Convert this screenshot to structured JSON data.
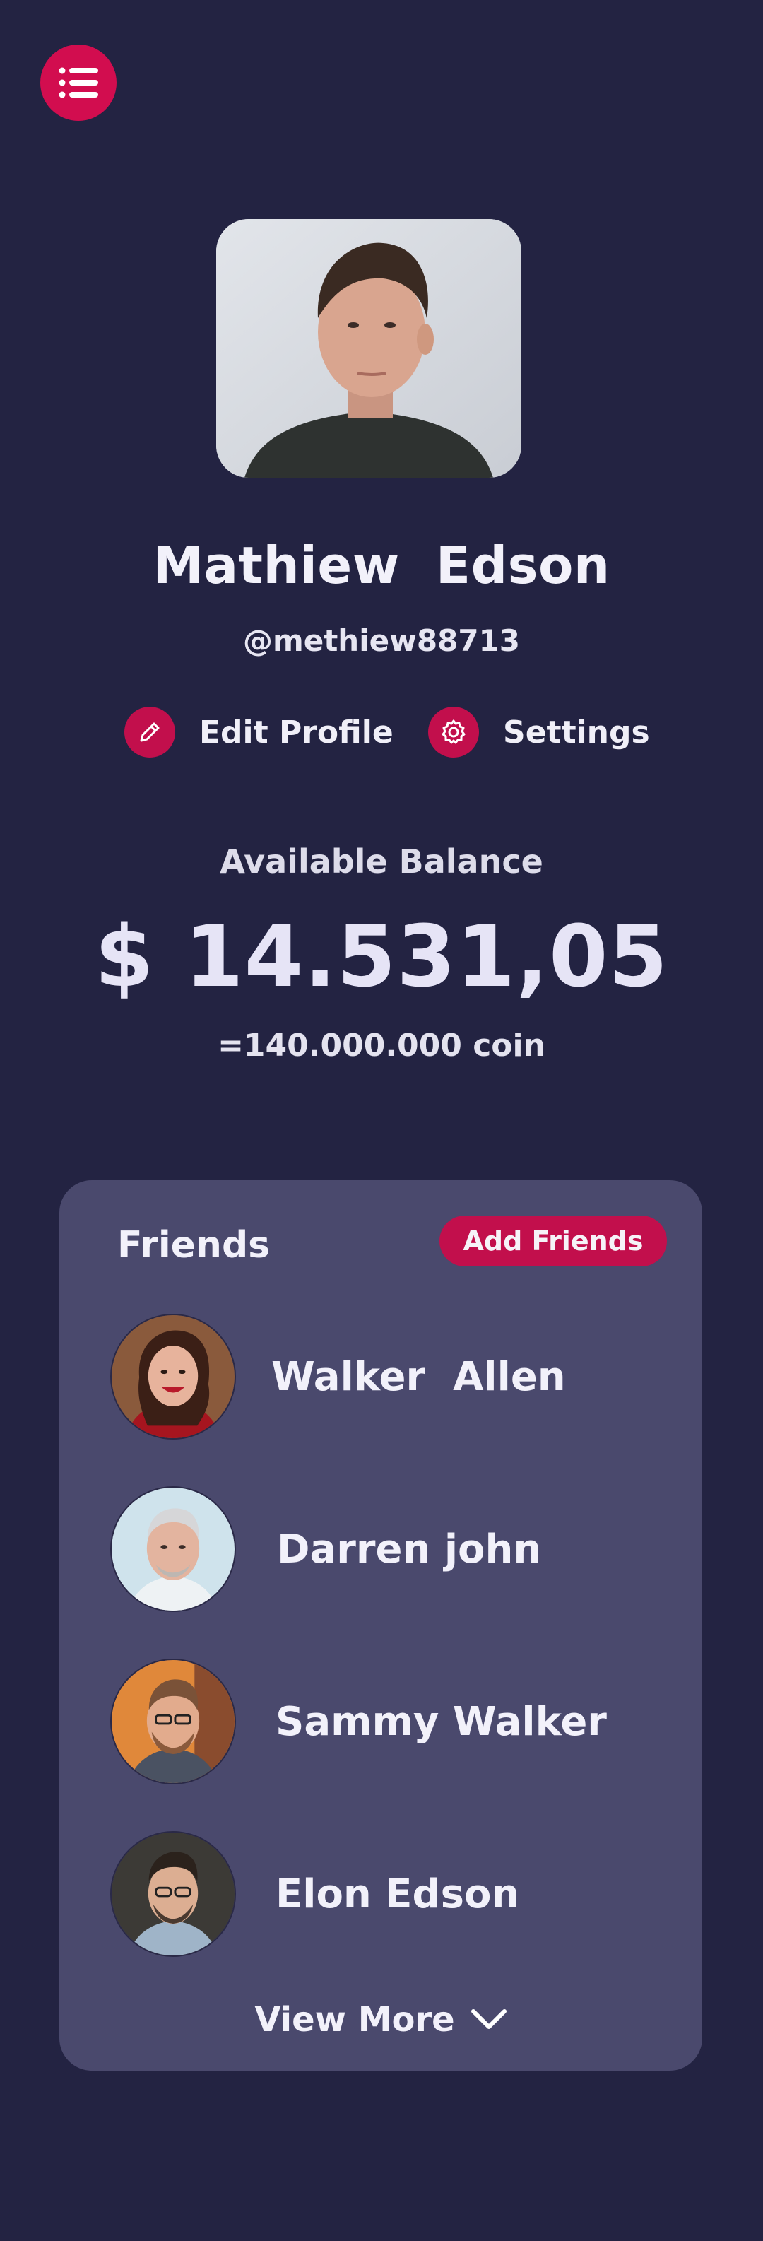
{
  "colors": {
    "background": "#232342",
    "card": "#4a496d",
    "accent": "#c20f4c",
    "text": "#f2f1fa"
  },
  "menu": {
    "icon": "list-menu-icon"
  },
  "profile": {
    "name": "Mathiew  Edson",
    "handle": "@methiew88713",
    "photo": "profile-photo"
  },
  "actions": {
    "edit_label": "Edit Profile",
    "edit_icon": "pencil-icon",
    "settings_label": "Settings",
    "settings_icon": "gear-icon"
  },
  "balance": {
    "label": "Available Balance",
    "amount": "$ 14.531,05",
    "coin": "=140.000.000 coin"
  },
  "friends": {
    "title": "Friends",
    "add_label": "Add Friends",
    "items": [
      {
        "name": "Walker  Allen"
      },
      {
        "name": "Darren john"
      },
      {
        "name": "Sammy Walker"
      },
      {
        "name": "Elon Edson"
      }
    ],
    "view_more_label": "View More",
    "view_more_icon": "chevron-down-icon"
  }
}
